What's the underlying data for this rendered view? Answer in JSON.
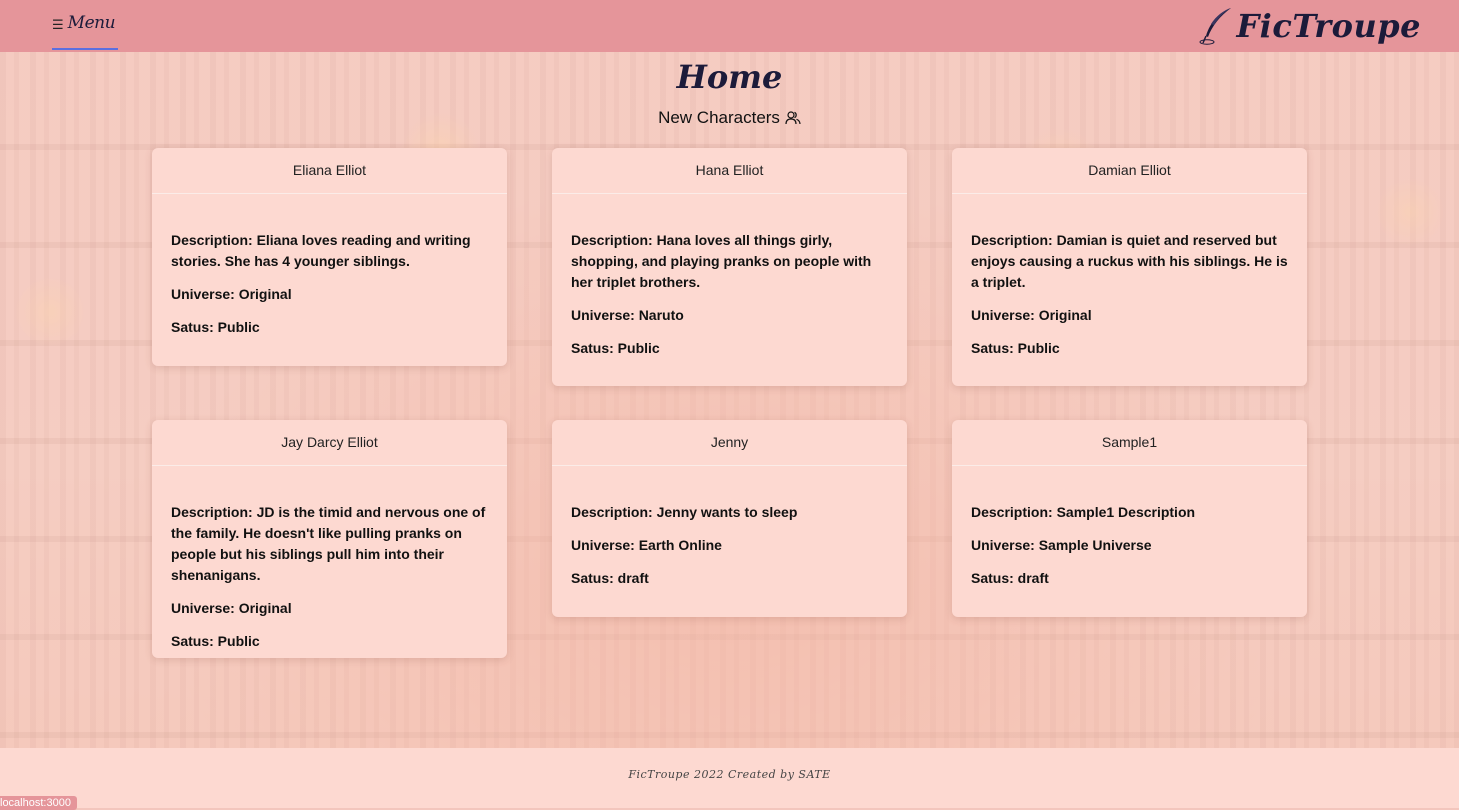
{
  "navbar": {
    "menu_label": "Menu",
    "menu_icon": "hamburger-icon",
    "brand": "FicTroupe",
    "brand_icon": "quill-icon"
  },
  "main": {
    "title": "Home",
    "subtitle": "New Characters",
    "subtitle_icon": "users-icon"
  },
  "cards": [
    {
      "name": "Eliana Elliot",
      "description": "Description: Eliana loves reading and writing stories. She has 4 younger siblings.",
      "universe": "Universe: Original",
      "status": "Satus: Public"
    },
    {
      "name": "Hana Elliot",
      "description": "Description: Hana loves all things girly, shopping, and playing pranks on people with her triplet brothers.",
      "universe": "Universe: Naruto",
      "status": "Satus: Public"
    },
    {
      "name": "Damian Elliot",
      "description": "Description: Damian is quiet and reserved but enjoys causing a ruckus with his siblings. He is a triplet.",
      "universe": "Universe: Original",
      "status": "Satus: Public"
    },
    {
      "name": "Jay Darcy Elliot",
      "description": "Description: JD is the timid and nervous one of the family. He doesn't like pulling pranks on people but his siblings pull him into their shenanigans.",
      "universe": "Universe: Original",
      "status": "Satus: Public"
    },
    {
      "name": "Jenny",
      "description": "Description: Jenny wants to sleep",
      "universe": "Universe: Earth Online",
      "status": "Satus: draft"
    },
    {
      "name": "Sample1",
      "description": "Description: Sample1 Description",
      "universe": "Universe: Sample Universe",
      "status": "Satus: draft"
    }
  ],
  "footer": {
    "text": "FicTroupe 2022 Created by SATE"
  },
  "status_bar": {
    "url": "localhost:3000"
  },
  "colors": {
    "navbar": "#e5959a",
    "card": "#fdd9d1",
    "title_text": "#1c1b3a",
    "menu_underline": "#5b6fe0"
  }
}
